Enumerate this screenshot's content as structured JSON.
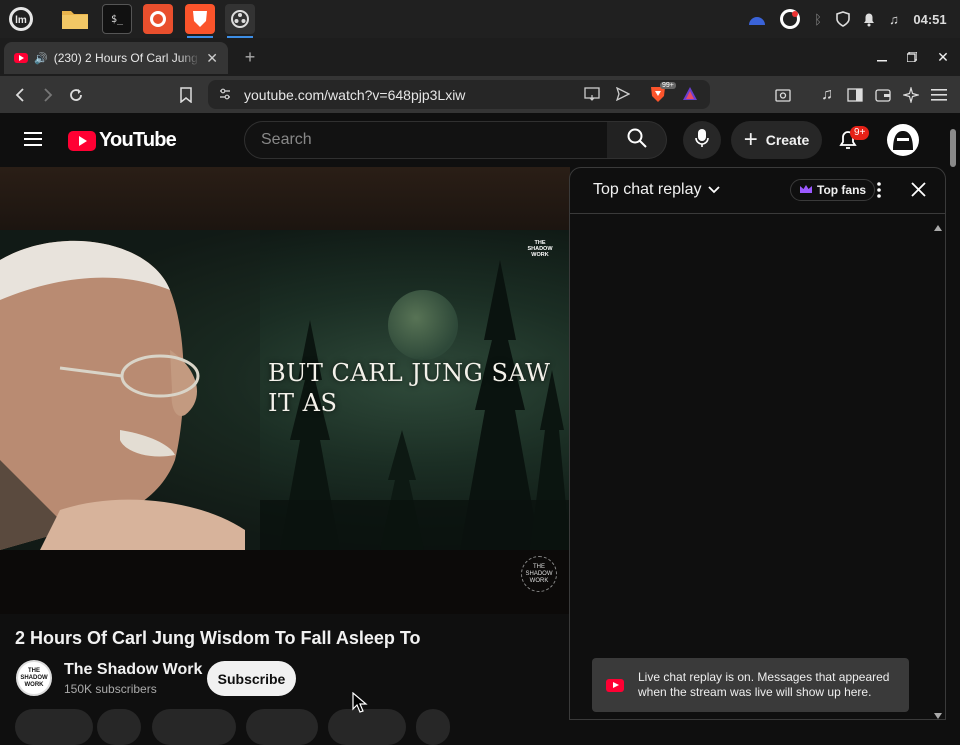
{
  "taskbar": {
    "clock": "04:51",
    "apps": [
      "mint-menu",
      "files",
      "terminal",
      "firefox",
      "brave",
      "obs"
    ]
  },
  "browser": {
    "tab_title": "(230) 2 Hours Of Carl Jung Wisdom To Fall Asleep To",
    "url": "youtube.com/watch?v=648pjp3Lxiw",
    "extension_badge": "99+"
  },
  "youtube": {
    "logo_text": "YouTube",
    "search_placeholder": "Search",
    "create_label": "Create",
    "notif_badge": "9+"
  },
  "video": {
    "caption": "BUT CARL JUNG SAW IT AS",
    "watermark_top": "THE SHADOW WORK",
    "watermark_bottom": "THE SHADOW WORK",
    "title": "2 Hours Of Carl Jung Wisdom To Fall Asleep To"
  },
  "channel": {
    "name": "The Shadow Work",
    "subscribers": "150K subscribers",
    "subscribe_label": "Subscribe",
    "avatar_text": "THE SHADOW WORK"
  },
  "chat": {
    "mode": "Top chat replay",
    "top_fans": "Top fans",
    "notice": "Live chat replay is on. Messages that appeared when the stream was live will show up here."
  },
  "colors": {
    "accent": "#3d8ee6",
    "youtube_red": "#ff0033",
    "brave_orange": "#fb542b"
  }
}
